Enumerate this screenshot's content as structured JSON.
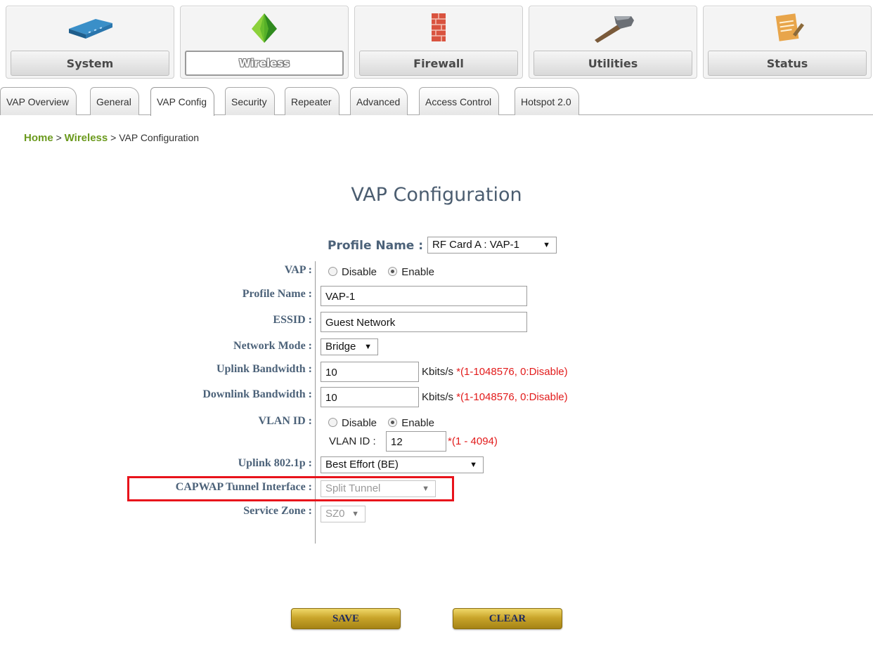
{
  "modules": [
    {
      "label": "System",
      "icon": "router-icon"
    },
    {
      "label": "Wireless",
      "icon": "wireless-icon"
    },
    {
      "label": "Firewall",
      "icon": "firewall-icon"
    },
    {
      "label": "Utilities",
      "icon": "hammer-icon"
    },
    {
      "label": "Status",
      "icon": "notepad-icon"
    }
  ],
  "active_module": "Wireless",
  "tabs": [
    {
      "label": "VAP Overview"
    },
    {
      "label": "General"
    },
    {
      "label": "VAP Config"
    },
    {
      "label": "Security"
    },
    {
      "label": "Repeater"
    },
    {
      "label": "Advanced"
    },
    {
      "label": "Access Control"
    },
    {
      "label": "Hotspot 2.0"
    }
  ],
  "active_tab": "VAP Config",
  "breadcrumb": {
    "home": "Home",
    "sep": ">",
    "section": "Wireless",
    "current": "VAP Configuration"
  },
  "page_title": "VAP Configuration",
  "profile_select": {
    "label": "Profile Name :",
    "value": "RF Card A : VAP-1"
  },
  "form": {
    "vap": {
      "label": "VAP :",
      "options": [
        "Disable",
        "Enable"
      ],
      "selected": "Enable"
    },
    "profile_name": {
      "label": "Profile Name :",
      "value": "VAP-1"
    },
    "essid": {
      "label": "ESSID :",
      "value": "Guest Network"
    },
    "network_mode": {
      "label": "Network Mode :",
      "value": "Bridge"
    },
    "uplink_bw": {
      "label": "Uplink Bandwidth :",
      "value": "10",
      "unit": "Kbits/s",
      "hint": "*(1-1048576, 0:Disable)"
    },
    "downlink_bw": {
      "label": "Downlink Bandwidth :",
      "value": "10",
      "unit": "Kbits/s",
      "hint": "*(1-1048576, 0:Disable)"
    },
    "vlan": {
      "label": "VLAN ID :",
      "options": [
        "Disable",
        "Enable"
      ],
      "selected": "Enable",
      "id_label": "VLAN ID :",
      "id_value": "12",
      "id_hint": "*(1 - 4094)"
    },
    "uplink_8021p": {
      "label": "Uplink 802.1p :",
      "value": "Best Effort (BE)"
    },
    "capwap": {
      "label": "CAPWAP Tunnel Interface :",
      "value": "Split Tunnel"
    },
    "service_zone": {
      "label": "Service Zone :",
      "value": "SZ0"
    }
  },
  "buttons": {
    "save": "SAVE",
    "clear": "CLEAR"
  },
  "colors": {
    "highlight_box": "#e8131b",
    "link_green": "#6b9a1e",
    "label_blue": "#4c6279",
    "hint_red": "#e21b1b",
    "button_gold": "#c9a52b"
  }
}
